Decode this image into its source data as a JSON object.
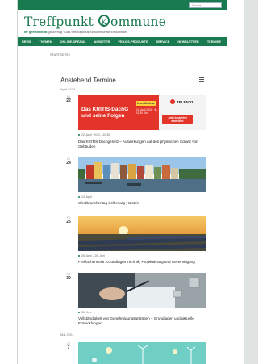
{
  "header": {
    "search_placeholder": "Suche ...",
    "logo_part1": "Treffpunkt ",
    "logo_k": "K",
    "logo_part2": "ommune",
    "tagline_bold": "Ihr gemeinderat",
    "tagline_rest": " gastverlag · Das Serviceportal für kommunale Entscheider"
  },
  "nav": [
    "NEWS",
    "THEMEN",
    "ONLINE-SPEZIAL",
    "ANBIETER",
    "PRAXIS-PRODUKTE",
    "SERVICE",
    "NEWSLETTER",
    "TERMINE"
  ],
  "breadcrumb": "STARTSEITE ›",
  "section_title": "Anstehend Termine ·",
  "months": [
    "April 2024",
    "Mai 2024"
  ],
  "events": [
    {
      "dow": "MI",
      "day": "22",
      "banner_title_line1": "Das KRITIS-DachG",
      "banner_title_line2": "und seine Folgen",
      "banner_live": "Live-Webinar",
      "banner_date": "22. April 2024 · 9 – 10.30 Uhr",
      "banner_cta": "Jetzt kostenfrei anmelden",
      "banner_brand": "TELENOT",
      "date": "22. April · 9:00 – 10:30",
      "title": "Das KRITIS-Dachgesetz – Auswirkungen auf den physischen Schutz von Gebäuden"
    },
    {
      "dow": "DI",
      "day": "24",
      "date": "24. April",
      "title": "Windbranchentag Schleswig-Holstein"
    },
    {
      "dow": "FR",
      "day": "26",
      "date": "26. April – 26. Juni",
      "title": "Freiflächensolar: Grundlagen Technik, Projektierung und Genehmigung"
    },
    {
      "dow": "SO",
      "day": "30",
      "date": "30. Juni",
      "title": "Vollständigkeit von Genehmigungsanträgen – Grundlagen und aktuelle Entwicklungen"
    },
    {
      "dow": "DI",
      "day": "7"
    }
  ],
  "colors": {
    "brand": "#1a7a4f",
    "banner_red": "#e3342a"
  }
}
